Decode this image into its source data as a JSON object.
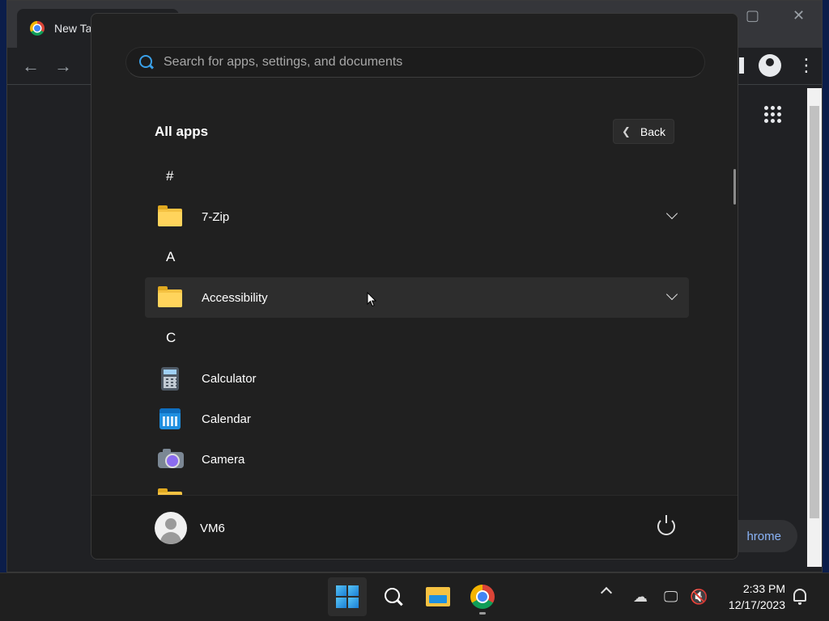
{
  "chrome": {
    "tab_title": "New Ta",
    "customize_label": "hrome"
  },
  "start_menu": {
    "search_placeholder": "Search for apps, settings, and documents",
    "all_apps_title": "All apps",
    "back_label": "Back",
    "sections": [
      {
        "letter": "#",
        "apps": [
          {
            "name": "7-Zip",
            "icon": "folder-icon",
            "expandable": true
          }
        ]
      },
      {
        "letter": "A",
        "apps": [
          {
            "name": "Accessibility",
            "icon": "folder-icon",
            "expandable": true,
            "hovered": true
          }
        ]
      },
      {
        "letter": "C",
        "apps": [
          {
            "name": "Calculator",
            "icon": "calculator-icon"
          },
          {
            "name": "Calendar",
            "icon": "calendar-icon"
          },
          {
            "name": "Camera",
            "icon": "camera-icon"
          }
        ]
      }
    ],
    "user_name": "VM6"
  },
  "taskbar": {
    "apps": [
      {
        "name": "start",
        "icon": "windows-logo-icon",
        "active": true
      },
      {
        "name": "search",
        "icon": "search-icon"
      },
      {
        "name": "file-explorer",
        "icon": "file-explorer-icon"
      },
      {
        "name": "chrome",
        "icon": "chrome-icon",
        "running": true
      }
    ],
    "time": "2:33 PM",
    "date": "12/17/2023"
  },
  "colors": {
    "start_bg": "#202020",
    "hover_bg": "#2d2d2d",
    "accent": "#3aa0e8"
  }
}
